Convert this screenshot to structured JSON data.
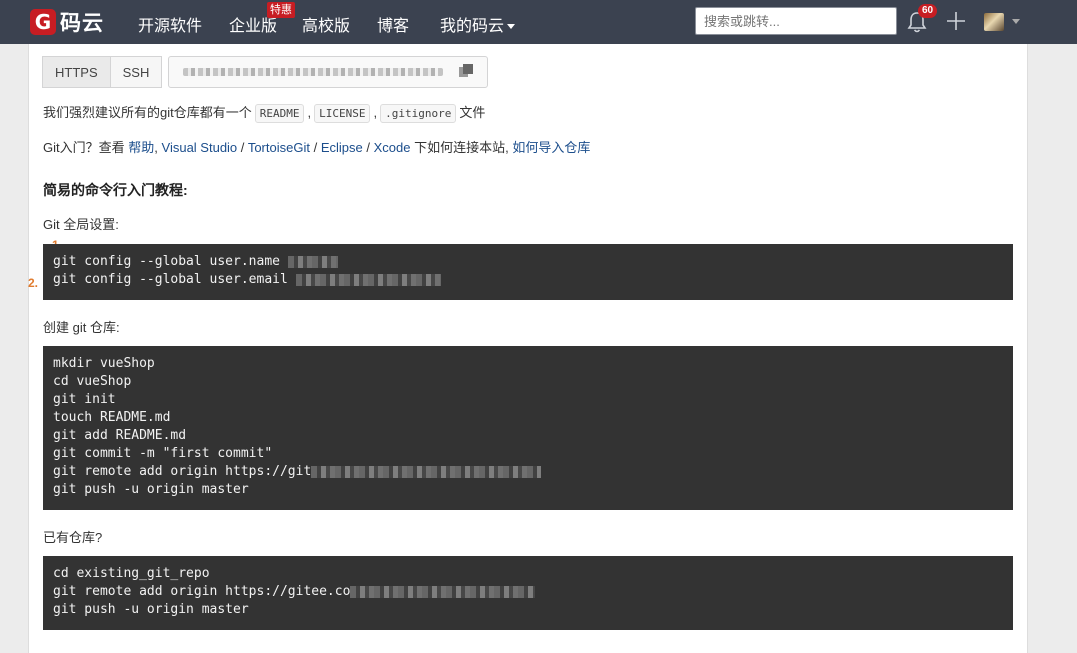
{
  "nav": {
    "logo_text": "码云",
    "items": [
      "开源软件",
      "企业版",
      "高校版",
      "博客",
      "我的码云"
    ],
    "hot_badge": "特惠",
    "search_placeholder": "搜索或跳转...",
    "notification_count": "60"
  },
  "clone": {
    "https_label": "HTTPS",
    "ssh_label": "SSH"
  },
  "intro": {
    "recommend_prefix": "我们强烈建议所有的git仓库都有一个",
    "readme": "README",
    "license": "LICENSE",
    "gitignore": ".gitignore",
    "recommend_suffix": "文件",
    "git_intro_prefix": "Git入门？查看",
    "help_link": "帮助",
    "sep1": ",",
    "vs_link": "Visual Studio",
    "slash1": "/",
    "tortoise_link": "TortoiseGit",
    "slash2": "/",
    "eclipse_link": "Eclipse",
    "slash3": "/",
    "xcode_link": "Xcode",
    "connect_text": "下如何连接本站,",
    "import_link": "如何导入仓库"
  },
  "tutorial": {
    "title": "简易的命令行入门教程:",
    "global_label": "Git 全局设置:",
    "global_lines": [
      "git config --global user.name ",
      "git config --global user.email "
    ],
    "create_label": "创建 git 仓库:",
    "create_lines": [
      "mkdir vueShop",
      "cd vueShop",
      "git init",
      "touch README.md",
      "git add README.md",
      "git commit -m \"first commit\"",
      "git remote add origin https://git",
      "git push -u origin master"
    ],
    "existing_label": "已有仓库?",
    "existing_lines": [
      "cd existing_git_repo",
      "git remote add origin https://gitee.co",
      "git push -u origin master"
    ]
  },
  "markers": {
    "one": "1",
    "two": "2."
  }
}
